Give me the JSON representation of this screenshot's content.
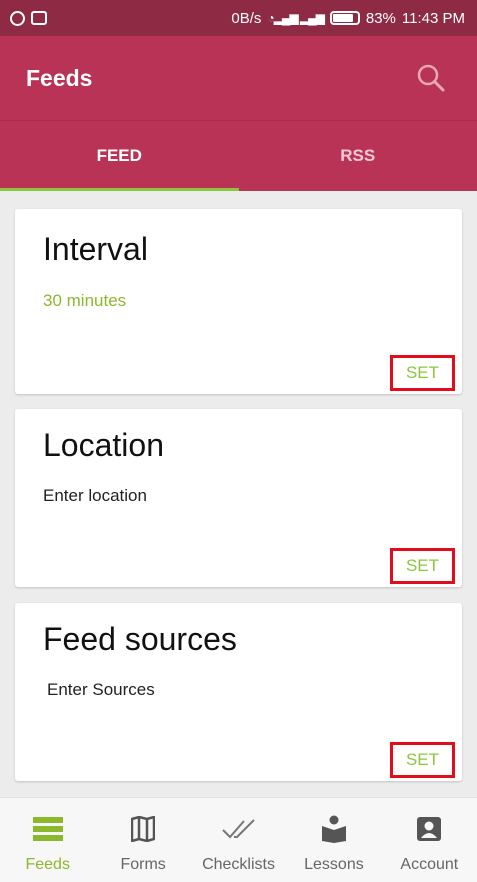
{
  "status_bar": {
    "network_speed": "0B/s",
    "battery": "83%",
    "time": "11:43 PM",
    "battery_level": 0.83
  },
  "app_bar": {
    "title": "Feeds",
    "search_icon": "search-icon"
  },
  "tabs": [
    {
      "label": "FEED",
      "active": true
    },
    {
      "label": "RSS",
      "active": false
    }
  ],
  "cards": [
    {
      "title": "Interval",
      "value": "30 minutes",
      "button": "SET"
    },
    {
      "title": "Location",
      "value": "Enter location",
      "button": "SET"
    },
    {
      "title": "Feed sources",
      "value": "Enter Sources",
      "button": "SET"
    }
  ],
  "bottom_nav": [
    {
      "label": "Feeds",
      "icon": "feeds-icon",
      "active": true
    },
    {
      "label": "Forms",
      "icon": "map-icon",
      "active": false
    },
    {
      "label": "Checklists",
      "icon": "double-check-icon",
      "active": false
    },
    {
      "label": "Lessons",
      "icon": "reader-icon",
      "active": false
    },
    {
      "label": "Account",
      "icon": "account-icon",
      "active": false
    }
  ],
  "colors": {
    "primary": "#b83356",
    "status_bar": "#8f2a45",
    "accent": "#8cc63f",
    "highlight_border": "#e30c1c"
  }
}
